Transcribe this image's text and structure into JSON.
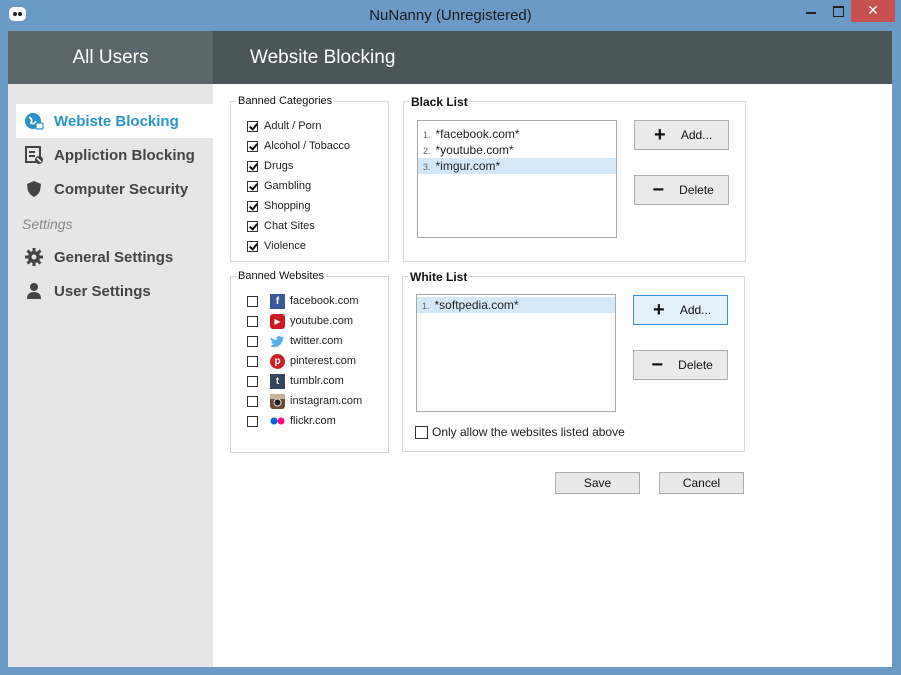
{
  "window": {
    "title": "NuNanny  (Unregistered)",
    "close_label": "✕"
  },
  "header": {
    "left_title": "All Users",
    "page_title": "Website Blocking"
  },
  "sidebar": {
    "items": [
      {
        "label": "Webiste Blocking",
        "icon": "globe-lock-icon",
        "active": true
      },
      {
        "label": "Appliction Blocking",
        "icon": "app-block-icon",
        "active": false
      },
      {
        "label": "Computer Security",
        "icon": "shield-icon",
        "active": false
      }
    ],
    "section_label": "Settings",
    "settings_items": [
      {
        "label": "General Settings",
        "icon": "gear-icon"
      },
      {
        "label": "User Settings",
        "icon": "user-icon"
      }
    ]
  },
  "banned_categories": {
    "label": "Banned Categories",
    "items": [
      {
        "label": "Adult / Porn",
        "checked": true
      },
      {
        "label": "Alcohol / Tobacco",
        "checked": true
      },
      {
        "label": "Drugs",
        "checked": true
      },
      {
        "label": "Gambling",
        "checked": true
      },
      {
        "label": "Shopping",
        "checked": true
      },
      {
        "label": "Chat Sites",
        "checked": true
      },
      {
        "label": "Violence",
        "checked": true
      }
    ]
  },
  "banned_websites": {
    "label": "Banned Websites",
    "items": [
      {
        "label": "facebook.com",
        "checked": false,
        "icon": "facebook-icon",
        "color": "#3b5998"
      },
      {
        "label": "youtube.com",
        "checked": false,
        "icon": "youtube-icon",
        "color": "#cc181e"
      },
      {
        "label": "twitter.com",
        "checked": false,
        "icon": "twitter-icon",
        "color": "#55acee"
      },
      {
        "label": "pinterest.com",
        "checked": false,
        "icon": "pinterest-icon",
        "color": "#cb2027"
      },
      {
        "label": "tumblr.com",
        "checked": false,
        "icon": "tumblr-icon",
        "color": "#35465c"
      },
      {
        "label": "instagram.com",
        "checked": false,
        "icon": "instagram-icon",
        "color": "#6b4a3a"
      },
      {
        "label": "flickr.com",
        "checked": false,
        "icon": "flickr-icon",
        "color": "#0063dc"
      }
    ]
  },
  "black_list": {
    "label": "Black List",
    "entries": [
      {
        "num": "1.",
        "value": "*facebook.com*",
        "selected": false
      },
      {
        "num": "2.",
        "value": "*youtube.com*",
        "selected": false
      },
      {
        "num": "3.",
        "value": "*imgur.com*",
        "selected": true
      }
    ],
    "add_label": "Add...",
    "delete_label": "Delete"
  },
  "white_list": {
    "label": "White List",
    "entries": [
      {
        "num": "1.",
        "value": "*softpedia.com*",
        "selected": true
      }
    ],
    "add_label": "Add...",
    "delete_label": "Delete",
    "only_allow_label": "Only allow the websites listed above",
    "only_allow_checked": false
  },
  "footer": {
    "save_label": "Save",
    "cancel_label": "Cancel"
  },
  "colors": {
    "accent": "#2a93c9",
    "header_bg": "#4a5659",
    "title_bar": "#6c9ac7",
    "close_button": "#c75050"
  }
}
